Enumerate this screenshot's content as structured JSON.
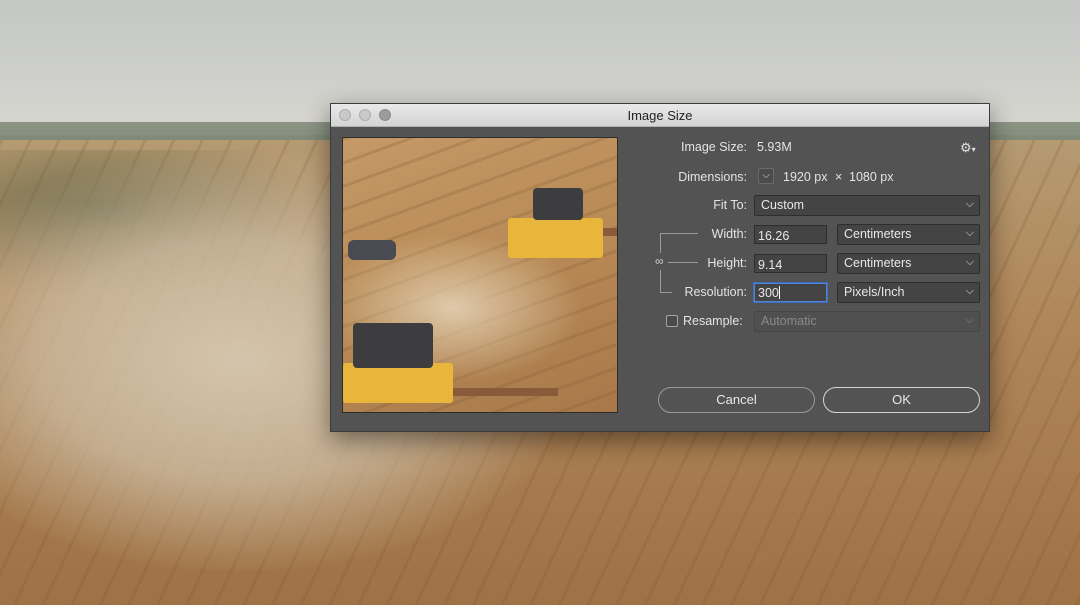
{
  "dialog": {
    "title": "Image Size",
    "image_size_label": "Image Size:",
    "image_size_value": "5.93M",
    "gear_icon": "gear-icon",
    "dimensions_label": "Dimensions:",
    "dimensions_chevron": "⌵",
    "dim_width": "1920 px",
    "dim_times": "×",
    "dim_height": "1080 px",
    "fit_to_label": "Fit To:",
    "fit_to_value": "Custom",
    "width_label": "Width:",
    "width_value": "16.26",
    "width_unit": "Centimeters",
    "height_label": "Height:",
    "height_value": "9.14",
    "height_unit": "Centimeters",
    "resolution_label": "Resolution:",
    "resolution_value": "300",
    "resolution_unit": "Pixels/Inch",
    "resample_label": "Resample:",
    "resample_checked": false,
    "resample_value": "Automatic",
    "cancel_label": "Cancel",
    "ok_label": "OK"
  }
}
